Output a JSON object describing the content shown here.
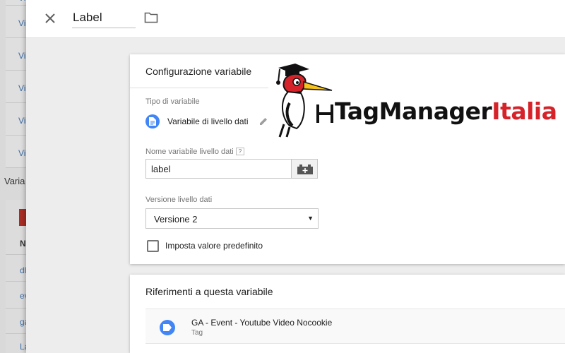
{
  "background": {
    "list_items": [
      "Vi",
      "Vi",
      "Vi",
      "Vi",
      "Vi",
      "Vi"
    ],
    "section_label": "Varia",
    "column_header": "N",
    "links": [
      "dl",
      "ev",
      "ga",
      "La"
    ]
  },
  "header": {
    "variable_name": "Label"
  },
  "config_card": {
    "title": "Configurazione variabile",
    "type_label": "Tipo di variabile",
    "type_value": "Variabile di livello dati",
    "dl_name_label": "Nome variabile livello dati",
    "dl_name_help": "?",
    "dl_name_value": "label",
    "version_label": "Versione livello dati",
    "version_value": "Versione 2",
    "default_checkbox_label": "Imposta valore predefinito"
  },
  "references_card": {
    "title": "Riferimenti a questa variabile",
    "items": [
      {
        "name": "GA - Event - Youtube Video Nocookie",
        "type": "Tag"
      }
    ]
  },
  "logo": {
    "brand_left": "TagManager",
    "brand_right": "Italia",
    "colors": {
      "dark": "#111111",
      "red": "#d6232a"
    }
  },
  "colors": {
    "accent_blue": "#4285f4",
    "link_blue": "#3c6ea8",
    "red_button": "#a82d25"
  }
}
